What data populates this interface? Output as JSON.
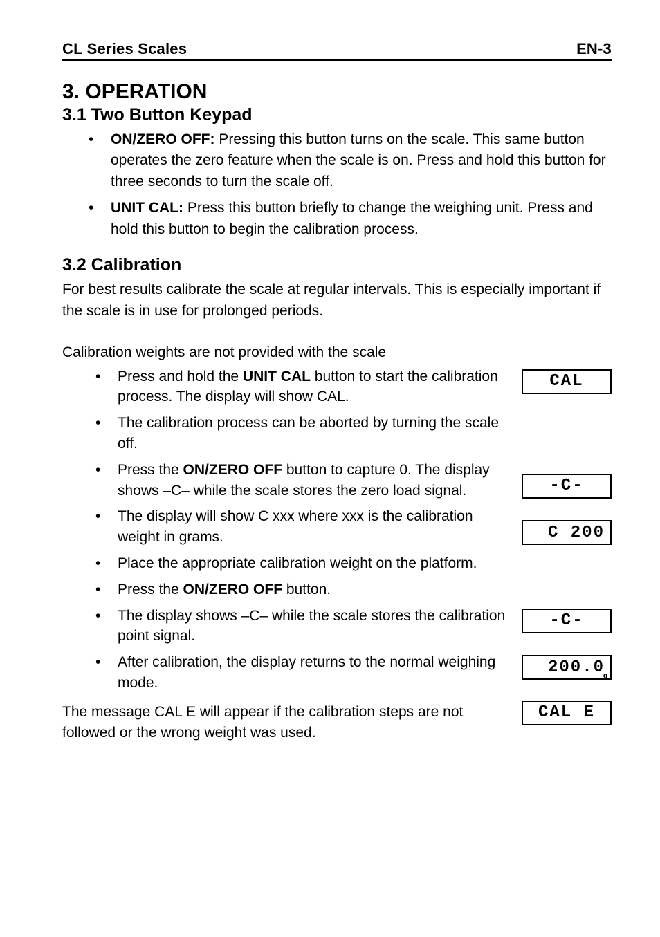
{
  "header": {
    "left": "CL Series Scales",
    "right": "EN-3"
  },
  "section": {
    "heading": "3. OPERATION",
    "sub1": {
      "heading": "3.1 Two Button Keypad",
      "items": [
        {
          "bold": "ON/ZERO OFF:",
          "text": "  Pressing this button turns on the scale.  This same button operates the zero feature when the scale is on.  Press and hold this button for three seconds to turn the scale off."
        },
        {
          "bold": "UNIT CAL:",
          "text": "  Press this button briefly to change the weighing unit.  Press and hold this button to begin the calibration process."
        }
      ]
    },
    "sub2": {
      "heading": "3.2 Calibration",
      "intro": "For best results calibrate the scale at regular intervals.  This is especially important if the scale is in use for prolonged periods.",
      "note": "Calibration weights are not provided with the scale",
      "steps": [
        {
          "pre": "Press and hold the ",
          "bold": "UNIT CAL",
          "post": " button to start the calibration process.  The display will show CAL.",
          "display": "CAL"
        },
        {
          "pre": "The calibration process can be aborted by turning the scale off.",
          "bold": "",
          "post": "",
          "display": ""
        },
        {
          "pre": "Press the ",
          "bold": "ON/ZERO OFF",
          "post": " button to capture 0.  The display shows –C– while the scale stores the zero load signal.",
          "display": "-C-"
        },
        {
          "pre": "The display will show C xxx where xxx is the calibration weight in grams.",
          "bold": "",
          "post": "",
          "display": "C 200"
        },
        {
          "pre": "Place the appropriate calibration weight on the platform.",
          "bold": "",
          "post": "",
          "display": ""
        },
        {
          "pre": "Press the ",
          "bold": "ON/ZERO OFF",
          "post": " button.",
          "display": ""
        },
        {
          "pre": "The display shows –C– while the scale stores the calibration point signal.",
          "bold": "",
          "post": "",
          "display": "-C-"
        },
        {
          "pre": "After calibration, the display returns to the normal weighing mode.",
          "bold": "",
          "post": "",
          "display": "200.0",
          "sub": "g"
        }
      ],
      "final_text": "The message CAL E will appear if the calibration steps are not followed or the wrong weight was used.",
      "final_display": "CAL E"
    }
  }
}
